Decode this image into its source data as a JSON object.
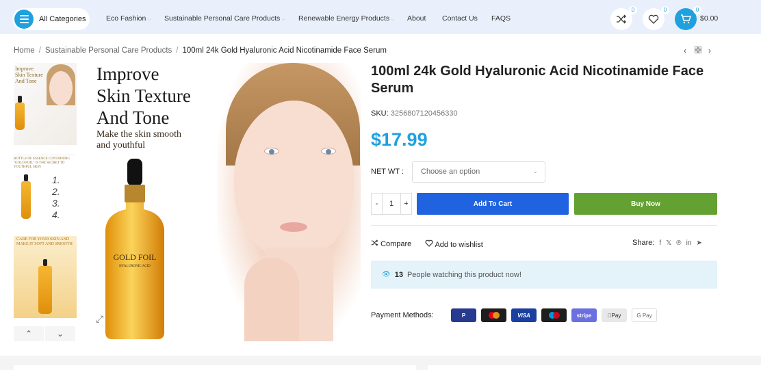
{
  "header": {
    "categories_label": "All Categories",
    "nav": [
      {
        "label": "Eco Fashion",
        "has_dropdown": true
      },
      {
        "label": "Sustainable Personal Care Products",
        "has_dropdown": true
      },
      {
        "label": "Renewable Energy Products",
        "has_dropdown": true
      },
      {
        "label": "About",
        "has_dropdown": false
      },
      {
        "label": "Contact Us",
        "has_dropdown": false
      },
      {
        "label": "FAQS",
        "has_dropdown": false
      }
    ],
    "compare_count": "0",
    "wishlist_count": "0",
    "cart_count": "0",
    "cart_total": "$0.00"
  },
  "breadcrumb": {
    "home": "Home",
    "category": "Sustainable Personal Care Products",
    "current": "100ml 24k Gold Hyaluronic Acid Nicotinamide Face Serum"
  },
  "gallery": {
    "headline": [
      "Improve",
      "Skin Texture",
      "And Tone"
    ],
    "subline": [
      "Make the skin smooth",
      "and youthful"
    ],
    "bottle_label": "GOLD FOIL",
    "bottle_sublabel": "HYALURONIC ACID",
    "thumb1_text": [
      "Improve",
      "Skin Texture",
      "And Tone"
    ],
    "thumb2_caption": "BOTTLE OF ESSENCE CONTAINING \"GOLD FOIL\" IS THE SECRET TO YOUTHFUL SKIN",
    "thumb3_text": [
      "CARE FOR YOUR SKIN AND",
      "MAKE IT SOFT AND SMOOTH"
    ]
  },
  "product": {
    "title": "100ml 24k Gold Hyaluronic Acid Nicotinamide Face Serum",
    "sku_label": "SKU:",
    "sku": "3256807120456330",
    "price": "$17.99",
    "option_label": "NET WT :",
    "option_placeholder": "Choose an option",
    "quantity": "1",
    "minus": "-",
    "plus": "+",
    "add_to_cart": "Add To Cart",
    "buy_now": "Buy Now",
    "compare": "Compare",
    "wishlist": "Add to wishlist",
    "share_label": "Share:",
    "watching_count": "13",
    "watching_text": "People watching this product now!",
    "payment_label": "Payment Methods:",
    "payments": [
      "PayPal",
      "Mastercard",
      "VISA",
      "Maestro",
      "stripe",
      "Apple Pay",
      "G Pay"
    ],
    "payment_texts": [
      "P",
      "",
      "VISA",
      "",
      "stripe",
      "Pay",
      "G Pay"
    ]
  },
  "colors": {
    "accent": "#1fa1e0",
    "add_to_cart": "#1f63e0",
    "buy_now": "#63a132",
    "header_bg": "#e9f0fb"
  }
}
